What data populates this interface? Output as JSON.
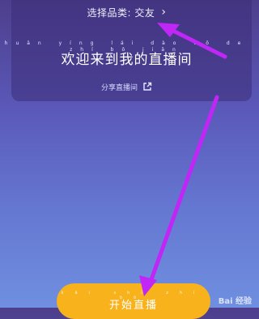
{
  "live_card": {
    "category_label": "选择品类: 交友",
    "title_pinyin": "huān yíng lái dào wǒ de zhí bō jiān",
    "title": "欢迎来到我的直播间",
    "share_label": "分享直播间"
  },
  "start_button": {
    "pinyin": "kāi shǐ zhí bō",
    "label": "开始直播"
  },
  "watermark": "Bai 经验"
}
